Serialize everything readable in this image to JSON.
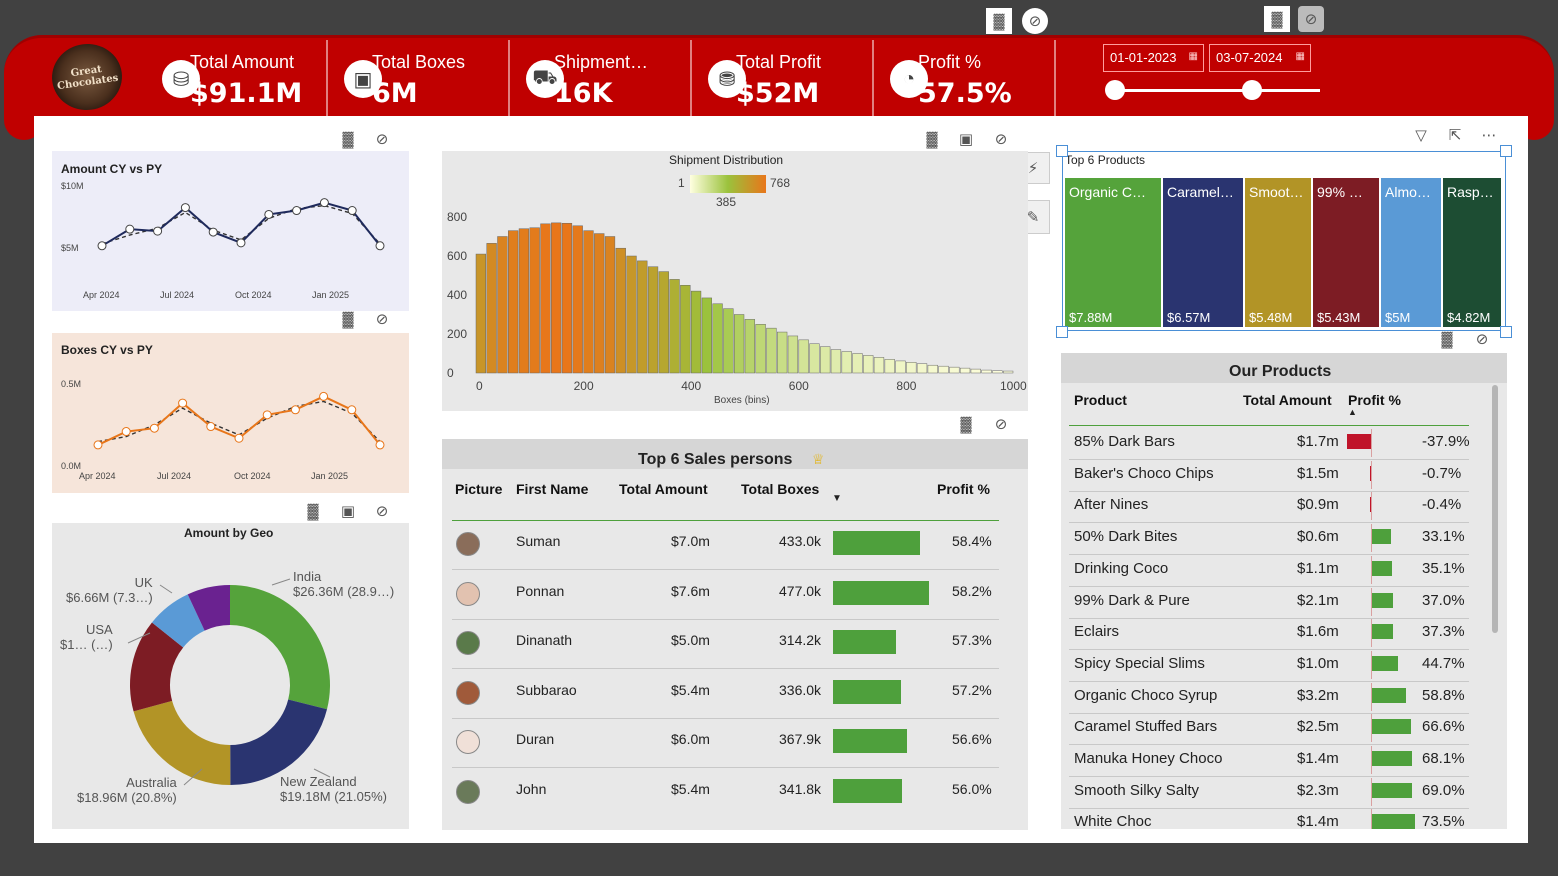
{
  "header": {
    "kpis": [
      {
        "label": "Total Amount",
        "value": "$91.1M",
        "icon": "coins-icon"
      },
      {
        "label": "Total Boxes",
        "value": "6M",
        "icon": "box-icon"
      },
      {
        "label": "Shipment…",
        "value": "16K",
        "icon": "truck-icon"
      },
      {
        "label": "Total Profit",
        "value": "$52M",
        "icon": "money-icon"
      },
      {
        "label": "Profit %",
        "value": "57.5%",
        "icon": "gauge-icon"
      }
    ],
    "date_from": "01-01-2023",
    "date_to": "03-07-2024",
    "logo_text": "Great Chocolates",
    "accent": "#c00000"
  },
  "amount_chart": {
    "title": "Amount CY vs PY",
    "ylabels": [
      "$10M",
      "$5M"
    ],
    "xlabels": [
      "Apr 2024",
      "Jul 2024",
      "Oct 2024",
      "Jan 2025"
    ],
    "cy": [
      4.0,
      5.7,
      5.5,
      7.9,
      5.4,
      4.3,
      7.2,
      7.6,
      8.4,
      7.6,
      4.0
    ],
    "py": [
      4.2,
      5.1,
      5.8,
      7.4,
      5.6,
      4.6,
      6.8,
      7.8,
      8.1,
      7.3,
      4.2
    ],
    "color": "#1f2a5c"
  },
  "boxes_chart": {
    "title": "Boxes CY vs PY",
    "ylabels": [
      "0.5M",
      "0.0M"
    ],
    "xlabels": [
      "Apr 2024",
      "Jul 2024",
      "Oct 2024",
      "Jan 2025"
    ],
    "cy": [
      0.12,
      0.2,
      0.22,
      0.37,
      0.23,
      0.16,
      0.3,
      0.33,
      0.41,
      0.33,
      0.12
    ],
    "py": [
      0.14,
      0.17,
      0.24,
      0.34,
      0.25,
      0.18,
      0.28,
      0.35,
      0.38,
      0.31,
      0.14
    ],
    "color": "#e8761a"
  },
  "geo_chart": {
    "title": "Amount by Geo",
    "slices": [
      {
        "name": "India",
        "label": "$26.36M (28.9…)",
        "pct": 28.9,
        "color": "#55a33b"
      },
      {
        "name": "New Zealand",
        "label": "$19.18M (21.05%)",
        "pct": 21.05,
        "color": "#2a3470"
      },
      {
        "name": "Australia",
        "label": "$18.96M (20.8%)",
        "pct": 20.8,
        "color": "#b29426"
      },
      {
        "name": "USA",
        "label": "$1… (…)",
        "pct": 15.0,
        "color": "#7d1c24"
      },
      {
        "name": "UK",
        "label": "$6.66M (7.3…)",
        "pct": 7.3,
        "color": "#5a9ad6"
      },
      {
        "name": "Other",
        "label": "",
        "pct": 6.95,
        "color": "#6a2290"
      }
    ]
  },
  "shipment_chart": {
    "title": "Shipment Distribution",
    "legend_min": "1",
    "legend_mid": "385",
    "legend_max": "768",
    "xlabel": "Boxes (bins)",
    "xticks": [
      "0",
      "200",
      "400",
      "600",
      "800",
      "1000"
    ],
    "yticks": [
      "800",
      "600",
      "400",
      "200",
      "0"
    ],
    "bins": [
      610,
      665,
      700,
      730,
      740,
      745,
      765,
      770,
      768,
      755,
      730,
      715,
      700,
      640,
      600,
      575,
      545,
      520,
      480,
      450,
      420,
      385,
      355,
      330,
      300,
      275,
      250,
      230,
      210,
      190,
      170,
      150,
      135,
      120,
      110,
      100,
      90,
      80,
      70,
      62,
      55,
      48,
      40,
      35,
      30,
      25,
      20,
      15,
      12,
      10
    ]
  },
  "sales_table": {
    "title": "Top 6 Sales persons",
    "columns": [
      "Picture",
      "First Name",
      "Total Amount",
      "Total Boxes",
      "Profit %"
    ],
    "rows": [
      {
        "name": "Suman",
        "amount": "$7.0m",
        "boxes": "433.0k",
        "boxes_val": 433.0,
        "profit": "58.4%"
      },
      {
        "name": "Ponnan",
        "amount": "$7.6m",
        "boxes": "477.0k",
        "boxes_val": 477.0,
        "profit": "58.2%"
      },
      {
        "name": "Dinanath",
        "amount": "$5.0m",
        "boxes": "314.2k",
        "boxes_val": 314.2,
        "profit": "57.3%"
      },
      {
        "name": "Subbarao",
        "amount": "$5.4m",
        "boxes": "336.0k",
        "boxes_val": 336.0,
        "profit": "57.2%"
      },
      {
        "name": "Duran",
        "amount": "$6.0m",
        "boxes": "367.9k",
        "boxes_val": 367.9,
        "profit": "56.6%"
      },
      {
        "name": "John",
        "amount": "$5.4m",
        "boxes": "341.8k",
        "boxes_val": 341.8,
        "profit": "56.0%"
      }
    ]
  },
  "top_products": {
    "title": "Top 6 Products",
    "items": [
      {
        "name": "Organic C…",
        "value": "$7.88M",
        "amount": 7.88,
        "color": "#55a33b"
      },
      {
        "name": "Caramel…",
        "value": "$6.57M",
        "amount": 6.57,
        "color": "#2a3470"
      },
      {
        "name": "Smoot…",
        "value": "$5.48M",
        "amount": 5.48,
        "color": "#b29426"
      },
      {
        "name": "99% …",
        "value": "$5.43M",
        "amount": 5.43,
        "color": "#7d1c24"
      },
      {
        "name": "Almo…",
        "value": "$5M",
        "amount": 5.0,
        "color": "#5a9ad6"
      },
      {
        "name": "Rasp…",
        "value": "$4.82M",
        "amount": 4.82,
        "color": "#1d4d33"
      }
    ]
  },
  "products_table": {
    "title": "Our Products",
    "columns": [
      "Product",
      "Total Amount",
      "Profit %"
    ],
    "rows": [
      {
        "name": "85% Dark Bars",
        "amount": "$1.7m",
        "profit": "-37.9%",
        "pv": -37.9
      },
      {
        "name": "Baker's Choco Chips",
        "amount": "$1.5m",
        "profit": "-0.7%",
        "pv": -0.7
      },
      {
        "name": "After Nines",
        "amount": "$0.9m",
        "profit": "-0.4%",
        "pv": -0.4
      },
      {
        "name": "50% Dark Bites",
        "amount": "$0.6m",
        "profit": "33.1%",
        "pv": 33.1
      },
      {
        "name": "Drinking Coco",
        "amount": "$1.1m",
        "profit": "35.1%",
        "pv": 35.1
      },
      {
        "name": "99% Dark & Pure",
        "amount": "$2.1m",
        "profit": "37.0%",
        "pv": 37.0
      },
      {
        "name": "Eclairs",
        "amount": "$1.6m",
        "profit": "37.3%",
        "pv": 37.3
      },
      {
        "name": "Spicy Special Slims",
        "amount": "$1.0m",
        "profit": "44.7%",
        "pv": 44.7
      },
      {
        "name": "Organic Choco Syrup",
        "amount": "$3.2m",
        "profit": "58.8%",
        "pv": 58.8
      },
      {
        "name": "Caramel Stuffed Bars",
        "amount": "$2.5m",
        "profit": "66.6%",
        "pv": 66.6
      },
      {
        "name": "Manuka Honey Choco",
        "amount": "$1.4m",
        "profit": "68.1%",
        "pv": 68.1
      },
      {
        "name": "Smooth Silky Salty",
        "amount": "$2.3m",
        "profit": "69.0%",
        "pv": 69.0
      },
      {
        "name": "White Choc",
        "amount": "$1.4m",
        "profit": "73.5%",
        "pv": 73.5
      }
    ]
  }
}
